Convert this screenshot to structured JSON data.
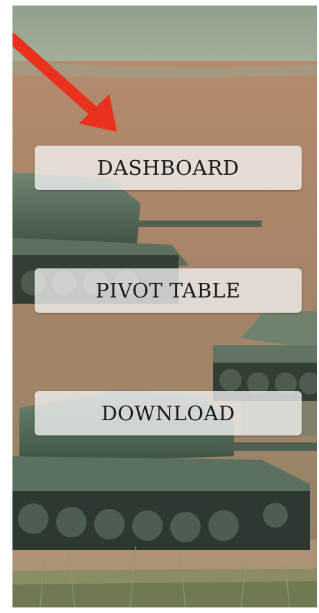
{
  "menu": {
    "dashboard_label": "DASHBOARD",
    "pivot_label": "PIVOT TABLE",
    "download_label": "DOWNLOAD"
  },
  "background": {
    "image": "tanks-on-field-photo"
  },
  "annotation": {
    "arrow_icon": "red-arrow-icon",
    "arrow_color": "#e8321e"
  },
  "colors": {
    "button_bg": "#f2f2f2",
    "button_text": "#1a1a1a"
  }
}
